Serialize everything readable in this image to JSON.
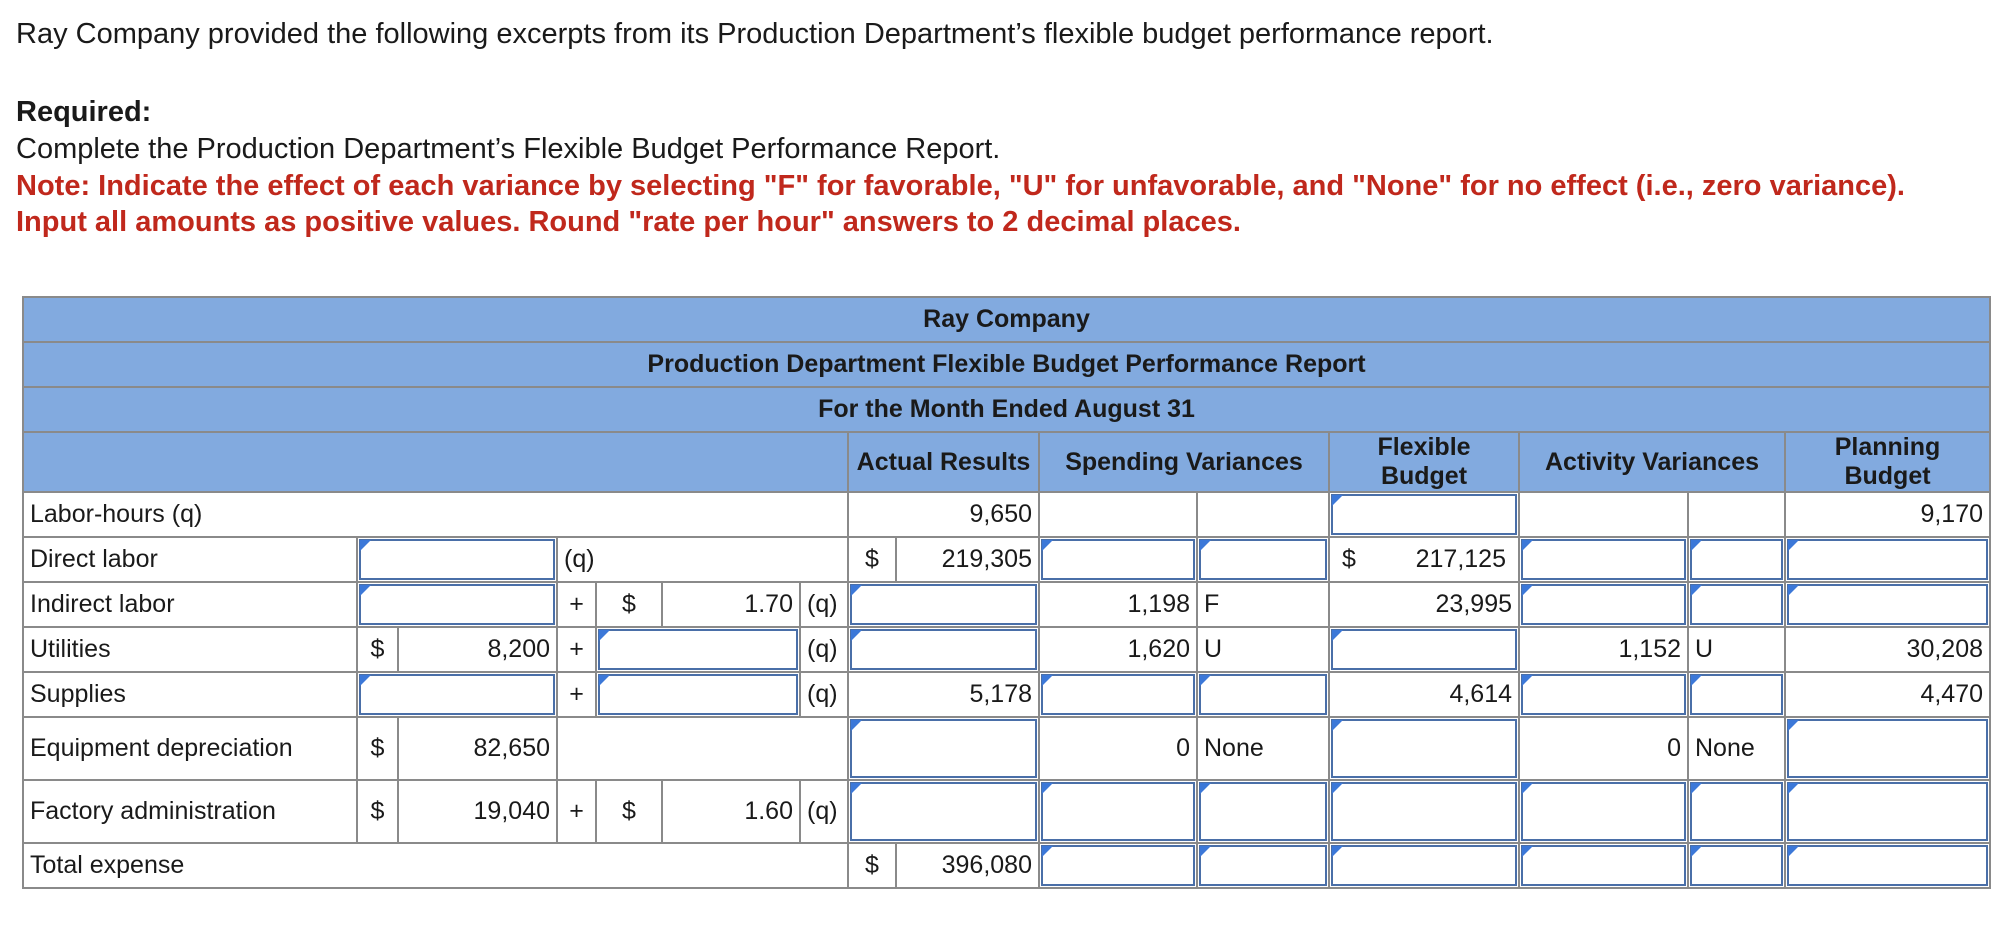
{
  "intro": "Ray Company provided the following excerpts from its Production Department’s flexible budget performance report.",
  "required_heading": "Required:",
  "required_text": "Complete the Production Department’s Flexible Budget Performance Report.",
  "note": "Note: Indicate the effect of each variance by selecting \"F\" for favorable, \"U\" for unfavorable, and \"None\" for no effect (i.e., zero variance). Input all amounts as positive values. Round \"rate per hour\" answers to 2 decimal places.",
  "report": {
    "company": "Ray Company",
    "title": "Production Department Flexible Budget Performance Report",
    "period": "For the Month Ended August 31",
    "col_actual": "Actual Results",
    "col_spending": "Spending Variances",
    "col_flexible": "Flexible Budget",
    "col_activity": "Activity Variances",
    "col_planning": "Planning Budget"
  },
  "symbols": {
    "dollar": "$",
    "plus": "+",
    "q": "(q)"
  },
  "rows": {
    "labor_hours": {
      "label": "Labor-hours (q)",
      "actual": "9,650",
      "planning": "9,170"
    },
    "direct_labor": {
      "label": "Direct labor",
      "actual": "219,305",
      "flexible": "217,125"
    },
    "indirect_labor": {
      "label": "Indirect labor",
      "rate": "1.70",
      "spending_amt": "1,198",
      "spending_eff": "F",
      "flexible": "23,995"
    },
    "utilities": {
      "label": "Utilities",
      "fixed": "8,200",
      "spending_amt": "1,620",
      "spending_eff": "U",
      "activity_amt": "1,152",
      "activity_eff": "U",
      "planning": "30,208"
    },
    "supplies": {
      "label": "Supplies",
      "actual": "5,178",
      "flexible": "4,614",
      "planning": "4,470"
    },
    "equipment_depreciation": {
      "label": "Equipment depreciation",
      "fixed": "82,650",
      "spending_amt": "0",
      "spending_eff": "None",
      "activity_amt": "0",
      "activity_eff": "None"
    },
    "factory_administration": {
      "label": "Factory administration",
      "fixed": "19,040",
      "rate": "1.60"
    },
    "total_expense": {
      "label": "Total expense",
      "actual": "396,080"
    }
  }
}
